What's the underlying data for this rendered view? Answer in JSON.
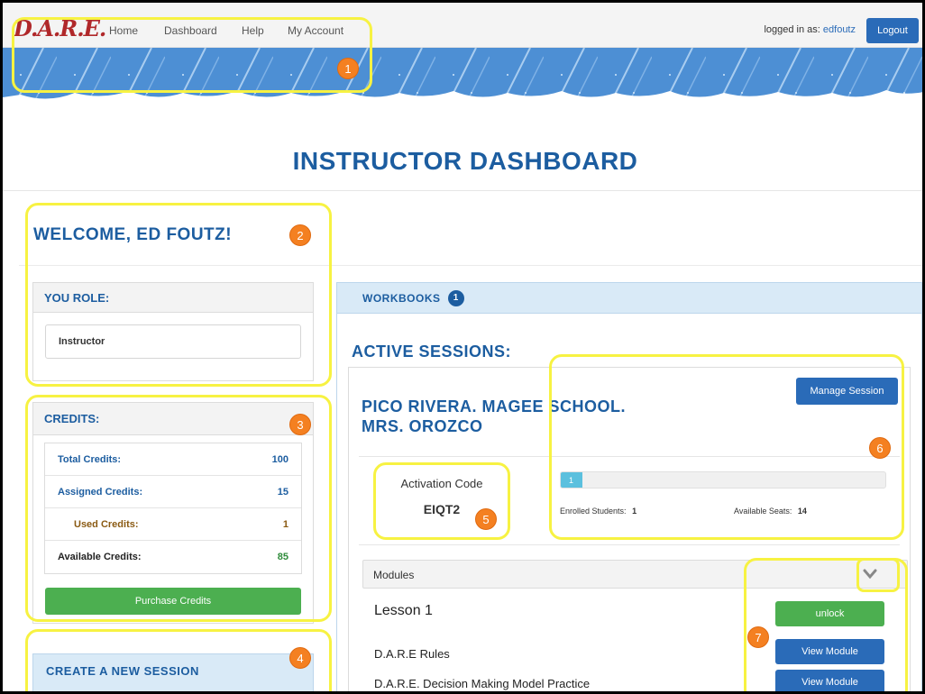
{
  "topbar": {
    "logo": "D.A.R.E.",
    "nav": [
      "Home",
      "Dashboard",
      "Help",
      "My Account"
    ],
    "logged_label": "logged in as:",
    "username": "edfoutz",
    "logout": "Logout"
  },
  "page_title": "INSTRUCTOR DASHBOARD",
  "welcome": "WELCOME, ED FOUTZ!",
  "role": {
    "heading": "YOU ROLE:",
    "value": "Instructor"
  },
  "credits": {
    "heading": "CREDITS:",
    "rows": [
      {
        "label": "Total Credits:",
        "value": "100"
      },
      {
        "label": "Assigned Credits:",
        "value": "15"
      },
      {
        "label": "Used Credits:",
        "value": "1"
      },
      {
        "label": "Available Credits:",
        "value": "85"
      }
    ],
    "purchase": "Purchase Credits"
  },
  "create_session": "CREATE A NEW SESSION",
  "workbooks": {
    "label": "WORKBOOKS",
    "count": "1"
  },
  "active_sessions": "ACTIVE SESSIONS:",
  "session": {
    "name_line1": "PICO RIVERA. MAGEE SCHOOL.",
    "name_line2": "MRS. OROZCO",
    "manage": "Manage Session",
    "activation_label": "Activation Code",
    "activation_code": "EIQT2",
    "progress_value": "1",
    "progress_fraction": 0.067,
    "enrolled_label": "Enrolled Students:",
    "enrolled_value": "1",
    "seats_label": "Available Seats:",
    "seats_value": "14"
  },
  "modules": {
    "heading": "Modules",
    "lesson": "Lesson 1",
    "unlock": "unlock",
    "items": [
      {
        "name": "D.A.R.E Rules",
        "button": "View Module"
      },
      {
        "name": "D.A.R.E. Decision Making Model Practice",
        "button": "View Module"
      }
    ]
  },
  "badges": [
    "1",
    "2",
    "3",
    "4",
    "5",
    "6",
    "7"
  ],
  "colors": {
    "brand_blue": "#1c5da0",
    "button_blue": "#2a6bb8",
    "green": "#4caf50",
    "highlight": "#f7f242",
    "badge": "#f48021"
  }
}
